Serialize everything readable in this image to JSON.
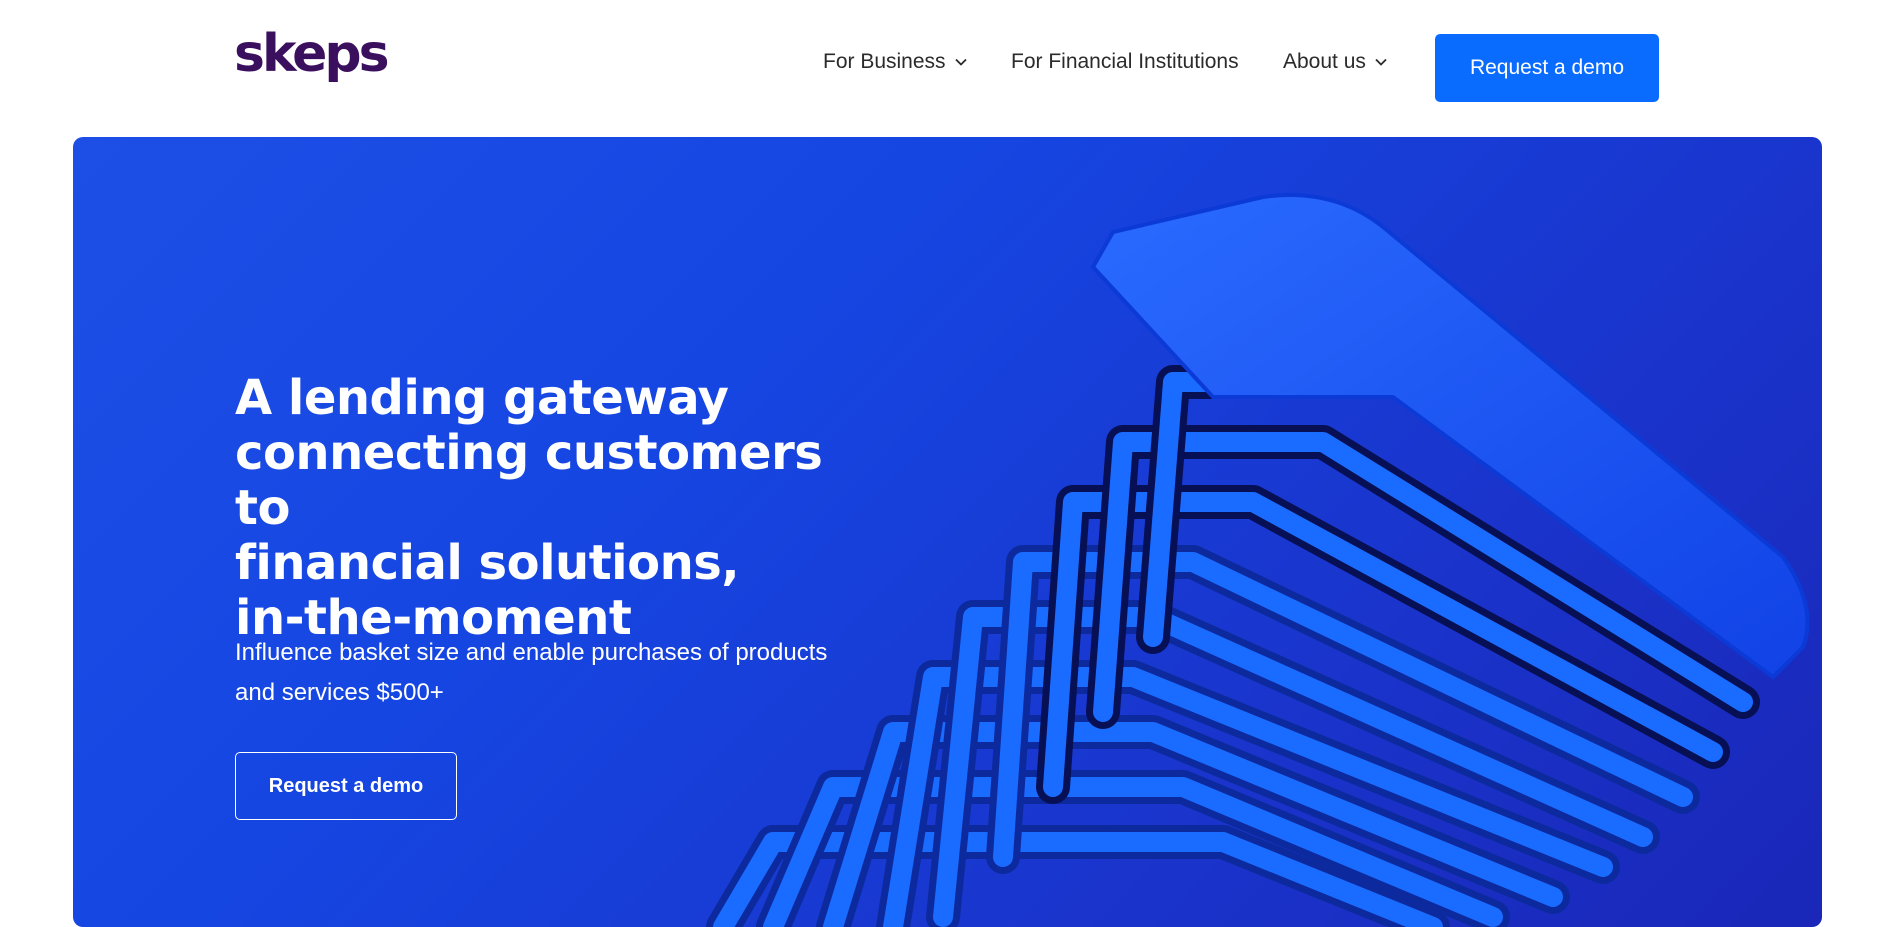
{
  "header": {
    "logo_text": "skeps",
    "nav": {
      "business": "For Business",
      "financial_institutions": "For Financial Institutions",
      "about": "About us"
    },
    "cta_label": "Request a demo"
  },
  "hero": {
    "headline_lines": [
      "A lending gateway",
      "connecting customers to",
      "financial solutions,",
      "in-the-moment"
    ],
    "subtext_lines": [
      "Influence basket size and enable purchases of products",
      "and services $500+"
    ],
    "cta_label": "Request a demo"
  },
  "colors": {
    "brand_purple": "#3a0f5e",
    "primary_blue": "#0a6cff",
    "hero_blue": "#1646e2"
  },
  "icons": {
    "nav_dropdown": "chevron-down-icon"
  }
}
